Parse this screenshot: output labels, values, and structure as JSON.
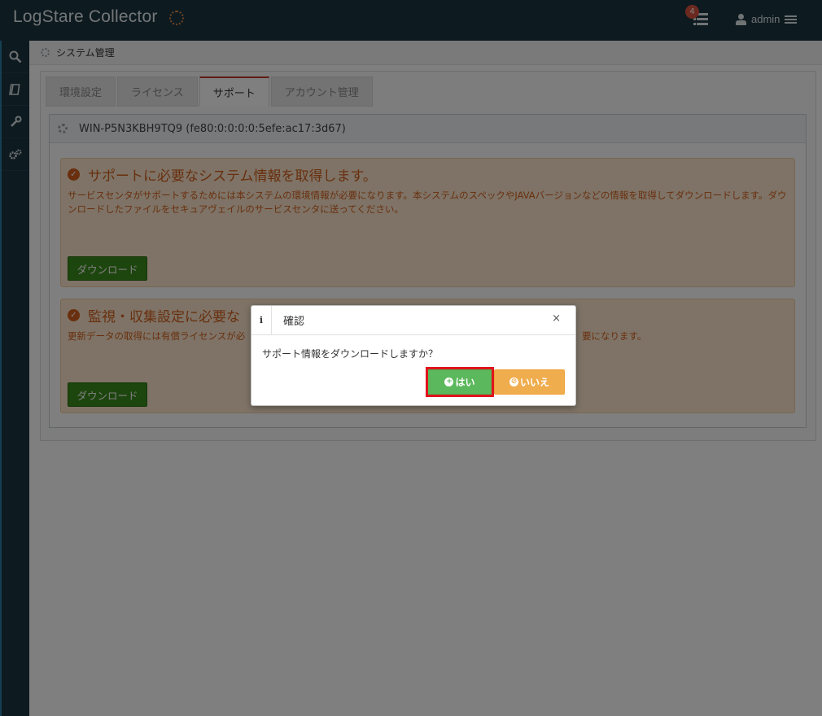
{
  "header": {
    "app_title": "LogStare Collector",
    "task_count": "4",
    "user_name": "admin"
  },
  "sidebar": {
    "items": [
      {
        "icon": "search-icon"
      },
      {
        "icon": "book-icon"
      },
      {
        "icon": "wrench-icon"
      },
      {
        "icon": "gears-icon"
      }
    ]
  },
  "breadcrumb": {
    "title": "システム管理"
  },
  "tabs": [
    {
      "label": "環境設定",
      "active": false
    },
    {
      "label": "ライセンス",
      "active": false
    },
    {
      "label": "サポート",
      "active": true
    },
    {
      "label": "アカウント管理",
      "active": false
    }
  ],
  "host": {
    "label": "WIN-P5N3KBH9TQ9 (fe80:0:0:0:0:5efe:ac17:3d67)"
  },
  "sections": [
    {
      "title": "サポートに必要なシステム情報を取得します。",
      "text": "サービスセンタがサポートするためには本システムの環境情報が必要になります。本システムのスペックやJAVAバージョンなどの情報を取得してダウンロードします。ダウンロードしたファイルをセキュアヴェイルのサービスセンタに送ってください。",
      "button": "ダウンロード"
    },
    {
      "title": "監視・収集設定に必要な",
      "text_left": "更新データの取得には有償ライセンスが必",
      "text_right": "要になります。",
      "button": "ダウンロード"
    }
  ],
  "dialog": {
    "title": "確認",
    "close": "×",
    "message": "サポート情報をダウンロードしますか？",
    "yes_label": "はい",
    "no_label": "いいえ"
  },
  "colors": {
    "header_bg": "#1b3540",
    "accent_tab": "#c0392b",
    "notice_text": "#d25e1c",
    "yes_button": "#5cb85c",
    "no_button": "#f0ad4e",
    "highlight": "#e0141c"
  }
}
